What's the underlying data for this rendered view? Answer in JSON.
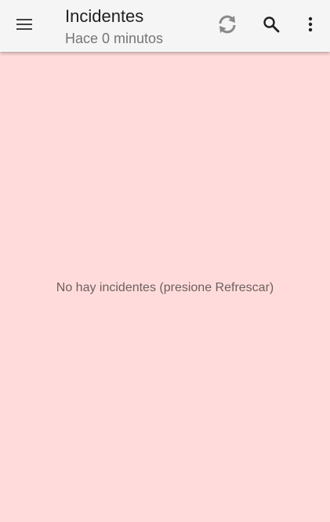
{
  "app_bar": {
    "title": "Incidentes",
    "subtitle": "Hace 0 minutos",
    "menu_icon": "hamburger-menu-icon",
    "refresh_icon": "refresh-icon",
    "search_icon": "search-icon",
    "more_icon": "more-vert-icon",
    "background": "#f5f5f5"
  },
  "content": {
    "empty_message": "No hay incidentes (presione Refrescar)",
    "background": "#ffdcdb"
  }
}
